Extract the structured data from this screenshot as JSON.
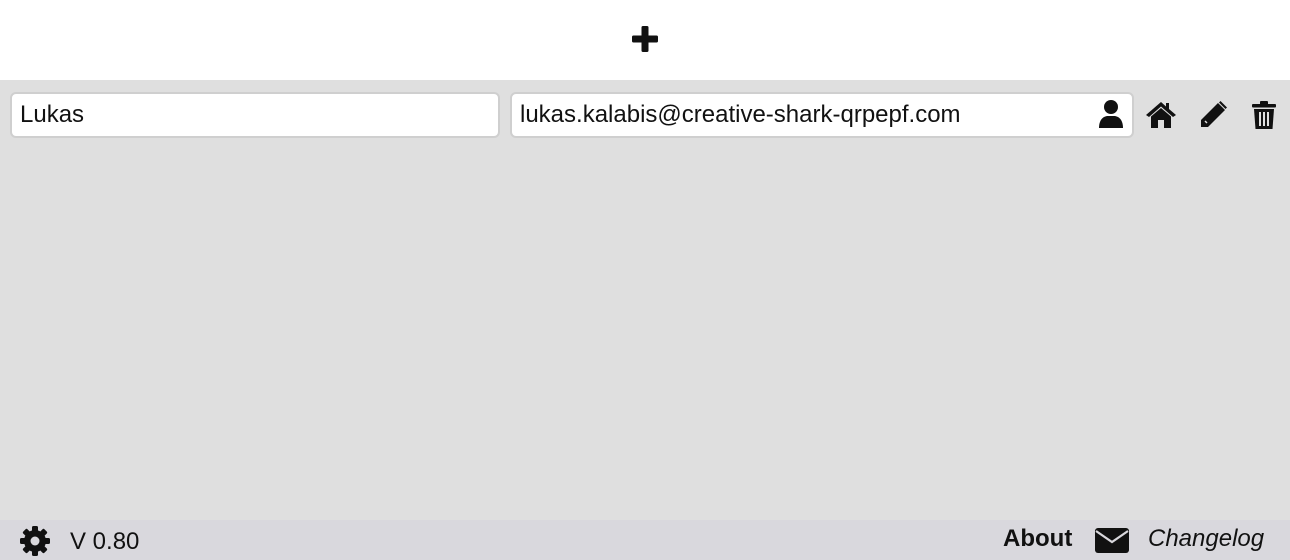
{
  "toolbar": {
    "add_icon": "plus-icon"
  },
  "entries": [
    {
      "name": "Lukas",
      "email": "lukas.kalabis@creative-shark-qrpepf.com",
      "icons": [
        "person-icon",
        "home-icon",
        "pencil-icon",
        "trash-icon"
      ]
    }
  ],
  "footer": {
    "settings_icon": "gear-icon",
    "version": "V 0.80",
    "about_label": "About",
    "mail_icon": "envelope-icon",
    "changelog_label": "Changelog"
  },
  "colors": {
    "main_background": "#dfdfdf",
    "footer_background": "#d9d8dd",
    "top_background": "#ffffff",
    "icon_color": "#111111"
  }
}
